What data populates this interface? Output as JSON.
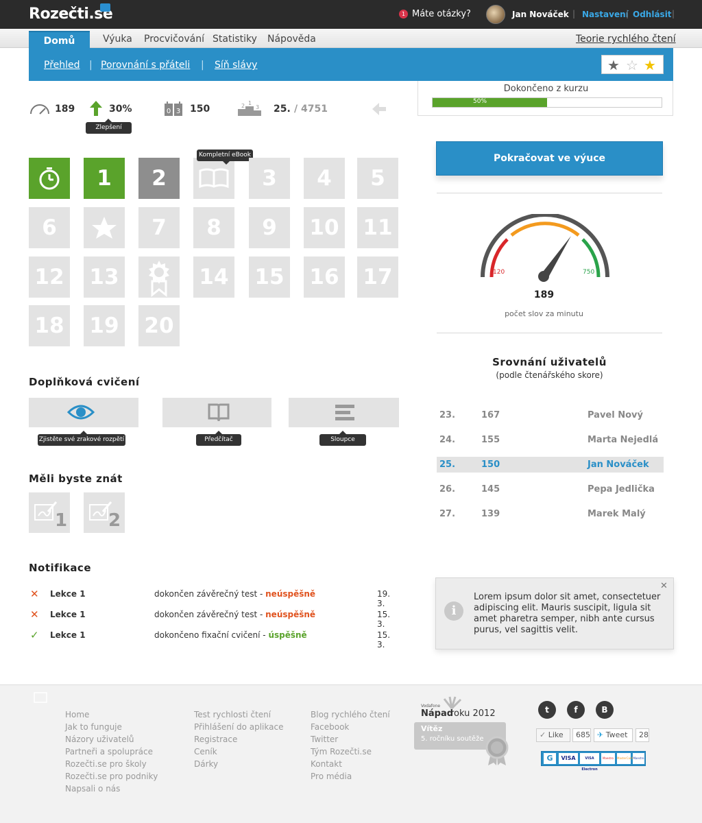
{
  "header": {
    "logo": "Rozečti.se",
    "questions_count": "1",
    "questions_label": "Máte otázky?",
    "user_name": "Jan Nováček",
    "settings_label": "Nastavení",
    "logout_label": "Odhlásit"
  },
  "nav": {
    "home": "Domů",
    "items": [
      "Výuka",
      "Procvičování",
      "Statistiky",
      "Nápověda"
    ],
    "theory": "Teorie rychlého čtení"
  },
  "subnav": {
    "items": [
      "Přehled",
      "Porovnání s přáteli",
      "Síň slávy"
    ],
    "rating_stars": 1
  },
  "progress": {
    "label": "Dokončeno z kurzu",
    "text": "50%",
    "value": 0.5
  },
  "stats": {
    "speed": "189",
    "improvement": "30%",
    "improvement_tip": "Zlepšení",
    "score": "150",
    "rank": "25.",
    "rank_total": "/ 4751"
  },
  "lessons": {
    "ebook_tip": "Kompletní eBook",
    "tiles": [
      "1",
      "2",
      "3",
      "4",
      "5",
      "6",
      "7",
      "8",
      "9",
      "10",
      "11",
      "12",
      "13",
      "14",
      "15",
      "16",
      "17",
      "18",
      "19",
      "20"
    ]
  },
  "extras": {
    "title": "Doplňková cvičení",
    "items": [
      {
        "tip": "Zjistěte své zrakové rozpětí",
        "icon": "eye-icon"
      },
      {
        "tip": "Předčítač",
        "icon": "book-icon"
      },
      {
        "tip": "Sloupce",
        "icon": "columns-icon"
      }
    ]
  },
  "know": {
    "title": "Měli byste znát",
    "items": [
      "1",
      "2"
    ]
  },
  "notifications": {
    "title": "Notifikace",
    "rows": [
      {
        "lesson": "Lekce 1",
        "desc": "dokončen závěrečný test - ",
        "status": "neúspěšně",
        "ok": false,
        "date": "19. 3."
      },
      {
        "lesson": "Lekce 1",
        "desc": "dokončen závěrečný test - ",
        "status": "neúspěšně",
        "ok": false,
        "date": "15. 3."
      },
      {
        "lesson": "Lekce 1",
        "desc": "dokončeno fixační cvičení - ",
        "status": "úspěšně",
        "ok": true,
        "date": "15. 3."
      }
    ]
  },
  "right": {
    "continue": "Pokračovat ve výuce",
    "gauge_min": "120",
    "gauge_max": "750",
    "wpm": "189",
    "wpm_label": "počet slov za minutu",
    "compare_title": "Srovnání uživatelů",
    "compare_sub": "(podle čtenářského skore)",
    "ranking": [
      {
        "pos": "23.",
        "score": "167",
        "name": "Pavel Nový"
      },
      {
        "pos": "24.",
        "score": "155",
        "name": "Marta Nejedlá"
      },
      {
        "pos": "25.",
        "score": "150",
        "name": "Jan Nováček",
        "me": true
      },
      {
        "pos": "26.",
        "score": "145",
        "name": "Pepa Jedlička"
      },
      {
        "pos": "27.",
        "score": "139",
        "name": "Marek Malý"
      }
    ],
    "info_text": "Lorem ipsum dolor sit amet, consectetuer adipiscing elit. Mauris suscipit, ligula sit amet pharetra semper, nibh ante cursus purus, vel sagittis velit."
  },
  "footer": {
    "col1": [
      "Home",
      "Jak to funguje",
      "Názory uživatelů",
      "Partneři a spolupráce",
      "Rozečti.se pro školy",
      "Rozečti.se pro podniky",
      "Napsali o nás"
    ],
    "col2": [
      "Test rychlosti čtení",
      "Přihlášení do aplikace",
      "Registrace",
      "Ceník",
      "Dárky"
    ],
    "col3": [
      "Blog rychlého čtení",
      "Facebook",
      "Twitter",
      "Tým Rozečti.se",
      "Kontakt",
      "Pro média"
    ],
    "award_small": "Vodafone",
    "award_title_a": "Nápad",
    "award_title_b": "roku 2012",
    "award_winner": "Vítěz",
    "award_sub": "5. ročníku soutěže",
    "like_label": "Like",
    "like_count": "685",
    "tweet_label": "Tweet",
    "tweet_count": "28",
    "payments": [
      "VISA",
      "VISA Electron",
      "Maestro",
      "MasterCard",
      "Maestro"
    ]
  }
}
